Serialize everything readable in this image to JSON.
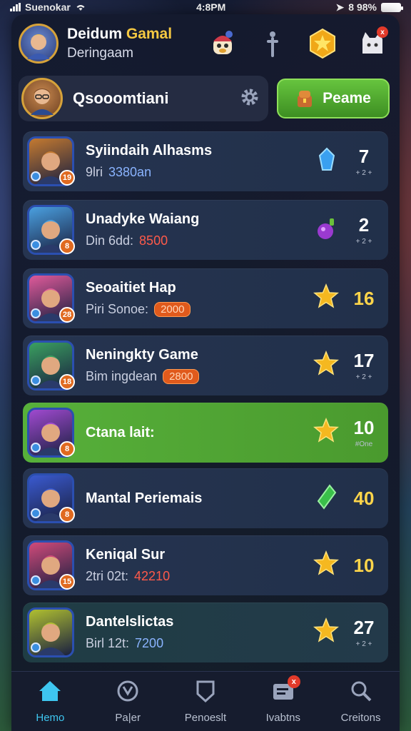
{
  "status_bar": {
    "carrier": "Suenokar",
    "time": "4:8PM",
    "battery": "8 98%",
    "battery_level": 0.98
  },
  "header": {
    "title_part1": "Deidum",
    "title_highlight": "Gamal",
    "subtitle": "Deringaam",
    "icons": [
      "mascot-icon",
      "tool-icon",
      "star-badge-icon",
      "cat-icon"
    ],
    "cat_badge": "x"
  },
  "search": {
    "value": "Qsooomtiani",
    "play_label": "Peame"
  },
  "leaderboard": [
    {
      "name": "Syiindaih Alhasms",
      "sub_label": "9lri",
      "sub_value": "3380an",
      "sub_style": "blue",
      "badge": "19",
      "avatar_bg": "#c47a30",
      "score": "7",
      "score_note": "+ 2 +",
      "trophy": "blue-gem",
      "score_color": "white",
      "style": "normal"
    },
    {
      "name": "Unadyke Waiang",
      "sub_label": "Din 6dd:",
      "sub_value": "8500",
      "sub_style": "red",
      "badge": "8",
      "avatar_bg": "#4aa0e0",
      "score": "2",
      "score_note": "+ 2 +",
      "trophy": "purple-potion",
      "score_color": "white",
      "style": "normal"
    },
    {
      "name": "Seoaitiet Hap",
      "sub_label": "Piri Sonoe:",
      "sub_value": "2000",
      "sub_style": "pill",
      "badge": "28",
      "avatar_bg": "#e05a9a",
      "score": "16",
      "score_note": "",
      "trophy": "gold-star",
      "score_color": "gold",
      "style": "normal"
    },
    {
      "name": "Neningkty Game",
      "sub_label": "Bim ingdean",
      "sub_value": "2800",
      "sub_style": "pill",
      "badge": "18",
      "avatar_bg": "#3aa060",
      "score": "17",
      "score_note": "+ 2 +",
      "trophy": "gold-star",
      "score_color": "white",
      "style": "normal"
    },
    {
      "name": "Ctana lait:",
      "sub_label": "",
      "sub_value": "",
      "sub_style": "none",
      "badge": "8",
      "avatar_bg": "#a04ad0",
      "score": "10",
      "score_note": "#One",
      "trophy": "gold-star",
      "score_color": "white",
      "style": "active"
    },
    {
      "name": "Mantal Periemais",
      "sub_label": "",
      "sub_value": "",
      "sub_style": "none",
      "badge": "8",
      "avatar_bg": "#3a5ad0",
      "score": "40",
      "score_note": "",
      "trophy": "green-gem",
      "score_color": "gold",
      "style": "normal"
    },
    {
      "name": "Keniqal Sur",
      "sub_label": "2tri 02t:",
      "sub_value": "42210",
      "sub_style": "red",
      "badge": "15",
      "avatar_bg": "#d04a7a",
      "score": "10",
      "score_note": "",
      "trophy": "gold-star",
      "score_color": "gold",
      "style": "normal"
    },
    {
      "name": "Dantelslictas",
      "sub_label": "Birl 12t:",
      "sub_value": "7200",
      "sub_style": "blue",
      "badge": "",
      "avatar_bg": "#b0c030",
      "score": "27",
      "score_note": "+ 2 +",
      "trophy": "gold-star",
      "score_color": "white",
      "style": "teal"
    }
  ],
  "nav": [
    {
      "label": "Hemo",
      "icon": "home-icon",
      "active": true,
      "badge": ""
    },
    {
      "label": "Pa|er",
      "icon": "player-icon",
      "active": false,
      "badge": ""
    },
    {
      "label": "Penoeslt",
      "icon": "shield-icon",
      "active": false,
      "badge": ""
    },
    {
      "label": "Ivabtns",
      "icon": "inbox-icon",
      "active": false,
      "badge": "x"
    },
    {
      "label": "Creitons",
      "icon": "search-people-icon",
      "active": false,
      "badge": ""
    }
  ],
  "colors": {
    "accent_green": "#57b03a",
    "gold": "#ffd54a",
    "nav_active": "#3ec6f0",
    "panel": "#141a2e"
  }
}
